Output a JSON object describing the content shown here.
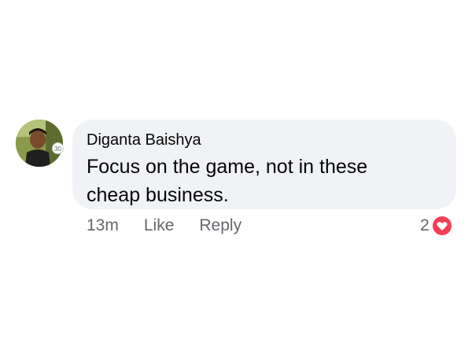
{
  "comment": {
    "author": "Diganta Baishya",
    "text": "Focus on the game, not in these cheap business.",
    "avatar_badge": "30",
    "timestamp": "13m",
    "like_label": "Like",
    "reply_label": "Reply",
    "reaction_count": "2",
    "reaction_icon": "heart-icon"
  },
  "colors": {
    "bubble": "#f0f2f5",
    "meta_text": "#65676b",
    "heart": "#f33e58"
  }
}
